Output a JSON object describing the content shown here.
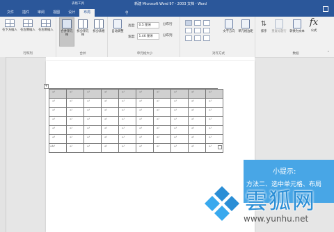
{
  "titlebar": {
    "context_group": "表格工具",
    "document_title": "新建 Microsoft Word 97 - 2003 文档 - Word",
    "tabs": [
      "文件",
      "插件",
      "审阅",
      "视图",
      "设计",
      "布局"
    ]
  },
  "ribbon": {
    "rows_cols_group": {
      "label": "行和列",
      "buttons": [
        "在下方插入",
        "在左侧插入",
        "在右侧插入"
      ]
    },
    "merge_group": {
      "label": "合并",
      "buttons": [
        "合并单元格",
        "拆分单元格",
        "拆分表格"
      ]
    },
    "cell_size_group": {
      "label": "单元格大小",
      "autofit": "自动调整",
      "height_label": "高度:",
      "height_value": "0.5 厘米",
      "width_label": "宽度:",
      "width_value": "1.46 厘米",
      "distribute_rows": "分布行",
      "distribute_cols": "分布列"
    },
    "alignment_group": {
      "label": "对齐方式",
      "buttons": [
        "文字方向",
        "单元格边距"
      ]
    },
    "data_group": {
      "label": "数据",
      "buttons": [
        "排序",
        "重复标题行",
        "转换为文本",
        "公式"
      ],
      "formula_symbol": "fx"
    }
  },
  "document": {
    "table": {
      "rows": 7,
      "cols": 10,
      "cell_mark": "↵",
      "selected_row": 0
    },
    "handle_symbol": "+",
    "paragraph_mark": "↵"
  },
  "tip": {
    "title": "小提示:",
    "body": "方法二、选中单元格、布局"
  },
  "watermark": {
    "name": "雲狐网",
    "url": "www.yunhu.net"
  }
}
